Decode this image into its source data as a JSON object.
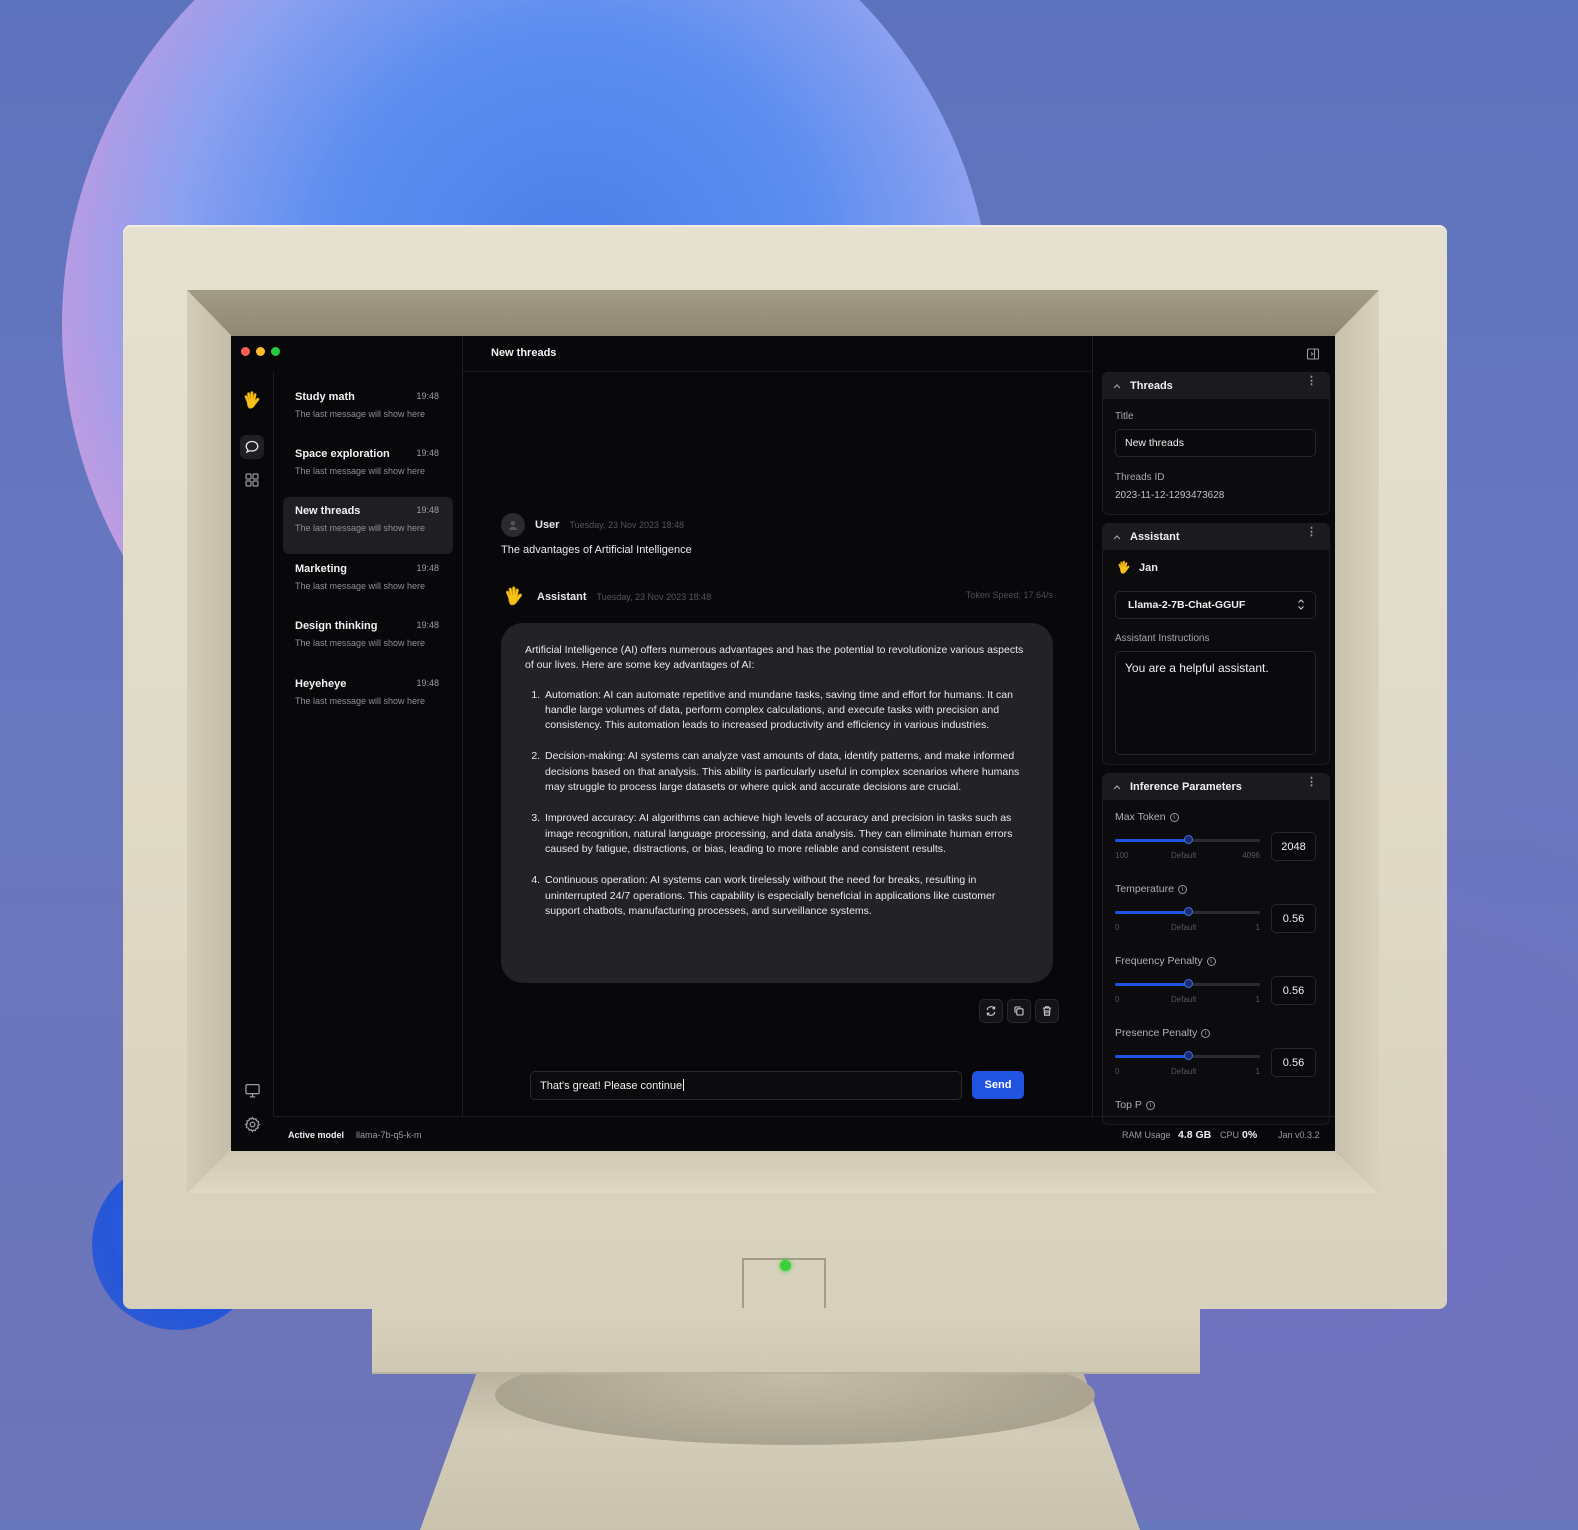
{
  "thread_list": [
    {
      "title": "Study math",
      "time": "19:48",
      "subtitle": "The last message will show here"
    },
    {
      "title": "Space exploration",
      "time": "19:48",
      "subtitle": "The last message will show here"
    },
    {
      "title": "New threads",
      "time": "19:48",
      "subtitle": "The last message will show here"
    },
    {
      "title": "Marketing",
      "time": "19:48",
      "subtitle": "The last message will show here"
    },
    {
      "title": "Design thinking",
      "time": "19:48",
      "subtitle": "The last message will show here"
    },
    {
      "title": "Heyeheye",
      "time": "19:48",
      "subtitle": "The last message will show here"
    }
  ],
  "main": {
    "title": "New threads",
    "user_message": {
      "name": "User",
      "timestamp": "Tuesday, 23 Nov 2023 18:48",
      "text": "The advantages of Artificial Intelligence"
    },
    "assistant_message": {
      "name": "Assistant",
      "timestamp": "Tuesday, 23 Nov 2023 18:48",
      "token_speed": "Token Speed: 17.64/s",
      "intro": "Artificial Intelligence (AI) offers numerous advantages and has the potential to revolutionize various aspects of our lives. Here are some key advantages of AI:",
      "points": [
        "Automation: AI can automate repetitive and mundane tasks, saving time and effort for humans. It can handle large volumes of data, perform complex calculations, and execute tasks with precision and consistency. This automation leads to increased productivity and efficiency in various industries.",
        "Decision-making: AI systems can analyze vast amounts of data, identify patterns, and make informed decisions based on that analysis. This ability is particularly useful in complex scenarios where humans may struggle to process large datasets or where quick and accurate decisions are crucial.",
        "Improved accuracy: AI algorithms can achieve high levels of accuracy and precision in tasks such as image recognition, natural language processing, and data analysis. They can eliminate human errors caused by fatigue, distractions, or bias, leading to more reliable and consistent results.",
        "Continuous operation: AI systems can work tirelessly without the need for breaks, resulting in uninterrupted 24/7 operations. This capability is especially beneficial in applications like customer support chatbots, manufacturing processes, and surveillance systems."
      ]
    },
    "input_value": "That's great! Please continue",
    "send_label": "Send"
  },
  "right_panel": {
    "threads": {
      "header": "Threads",
      "title_label": "Title",
      "title_value": "New threads",
      "id_label": "Threads ID",
      "id_value": "2023-11-12-1293473628"
    },
    "assistant": {
      "header": "Assistant",
      "name": "Jan",
      "model": "Llama-2-7B-Chat-GGUF",
      "instructions_label": "Assistant Instructions",
      "instructions_value": "You are a helpful assistant."
    },
    "inference": {
      "header": "Inference Parameters",
      "params": [
        {
          "label": "Max Token",
          "min": "100",
          "mid": "Default",
          "max": "4096",
          "value": "2048",
          "fill": 0.5
        },
        {
          "label": "Temperature",
          "min": "0",
          "mid": "Default",
          "max": "1",
          "value": "0.56",
          "fill": 0.5
        },
        {
          "label": "Frequency Penalty",
          "min": "0",
          "mid": "Default",
          "max": "1",
          "value": "0.56",
          "fill": 0.5
        },
        {
          "label": "Presence Penalty",
          "min": "0",
          "mid": "Default",
          "max": "1",
          "value": "0.56",
          "fill": 0.5
        }
      ],
      "top_p_label": "Top P"
    }
  },
  "status": {
    "active_model_label": "Active model",
    "active_model_value": "llama-7b-q5-k-m",
    "ram_label": "RAM Usage",
    "ram_value": "4.8 GB",
    "cpu_label": "CPU",
    "cpu_value": "0%",
    "version": "Jan v0.3.2"
  },
  "colors": {
    "accent": "#1f53e0",
    "screen_bg": "#08080a",
    "bubble_bg": "#232327",
    "bezel": "#e2ddcb"
  },
  "icons": {
    "logo": "waving-hand-icon",
    "chat": "chat-bubble-icon",
    "hub": "grid-icon",
    "system_monitor": "monitor-icon",
    "settings": "gear-icon"
  }
}
